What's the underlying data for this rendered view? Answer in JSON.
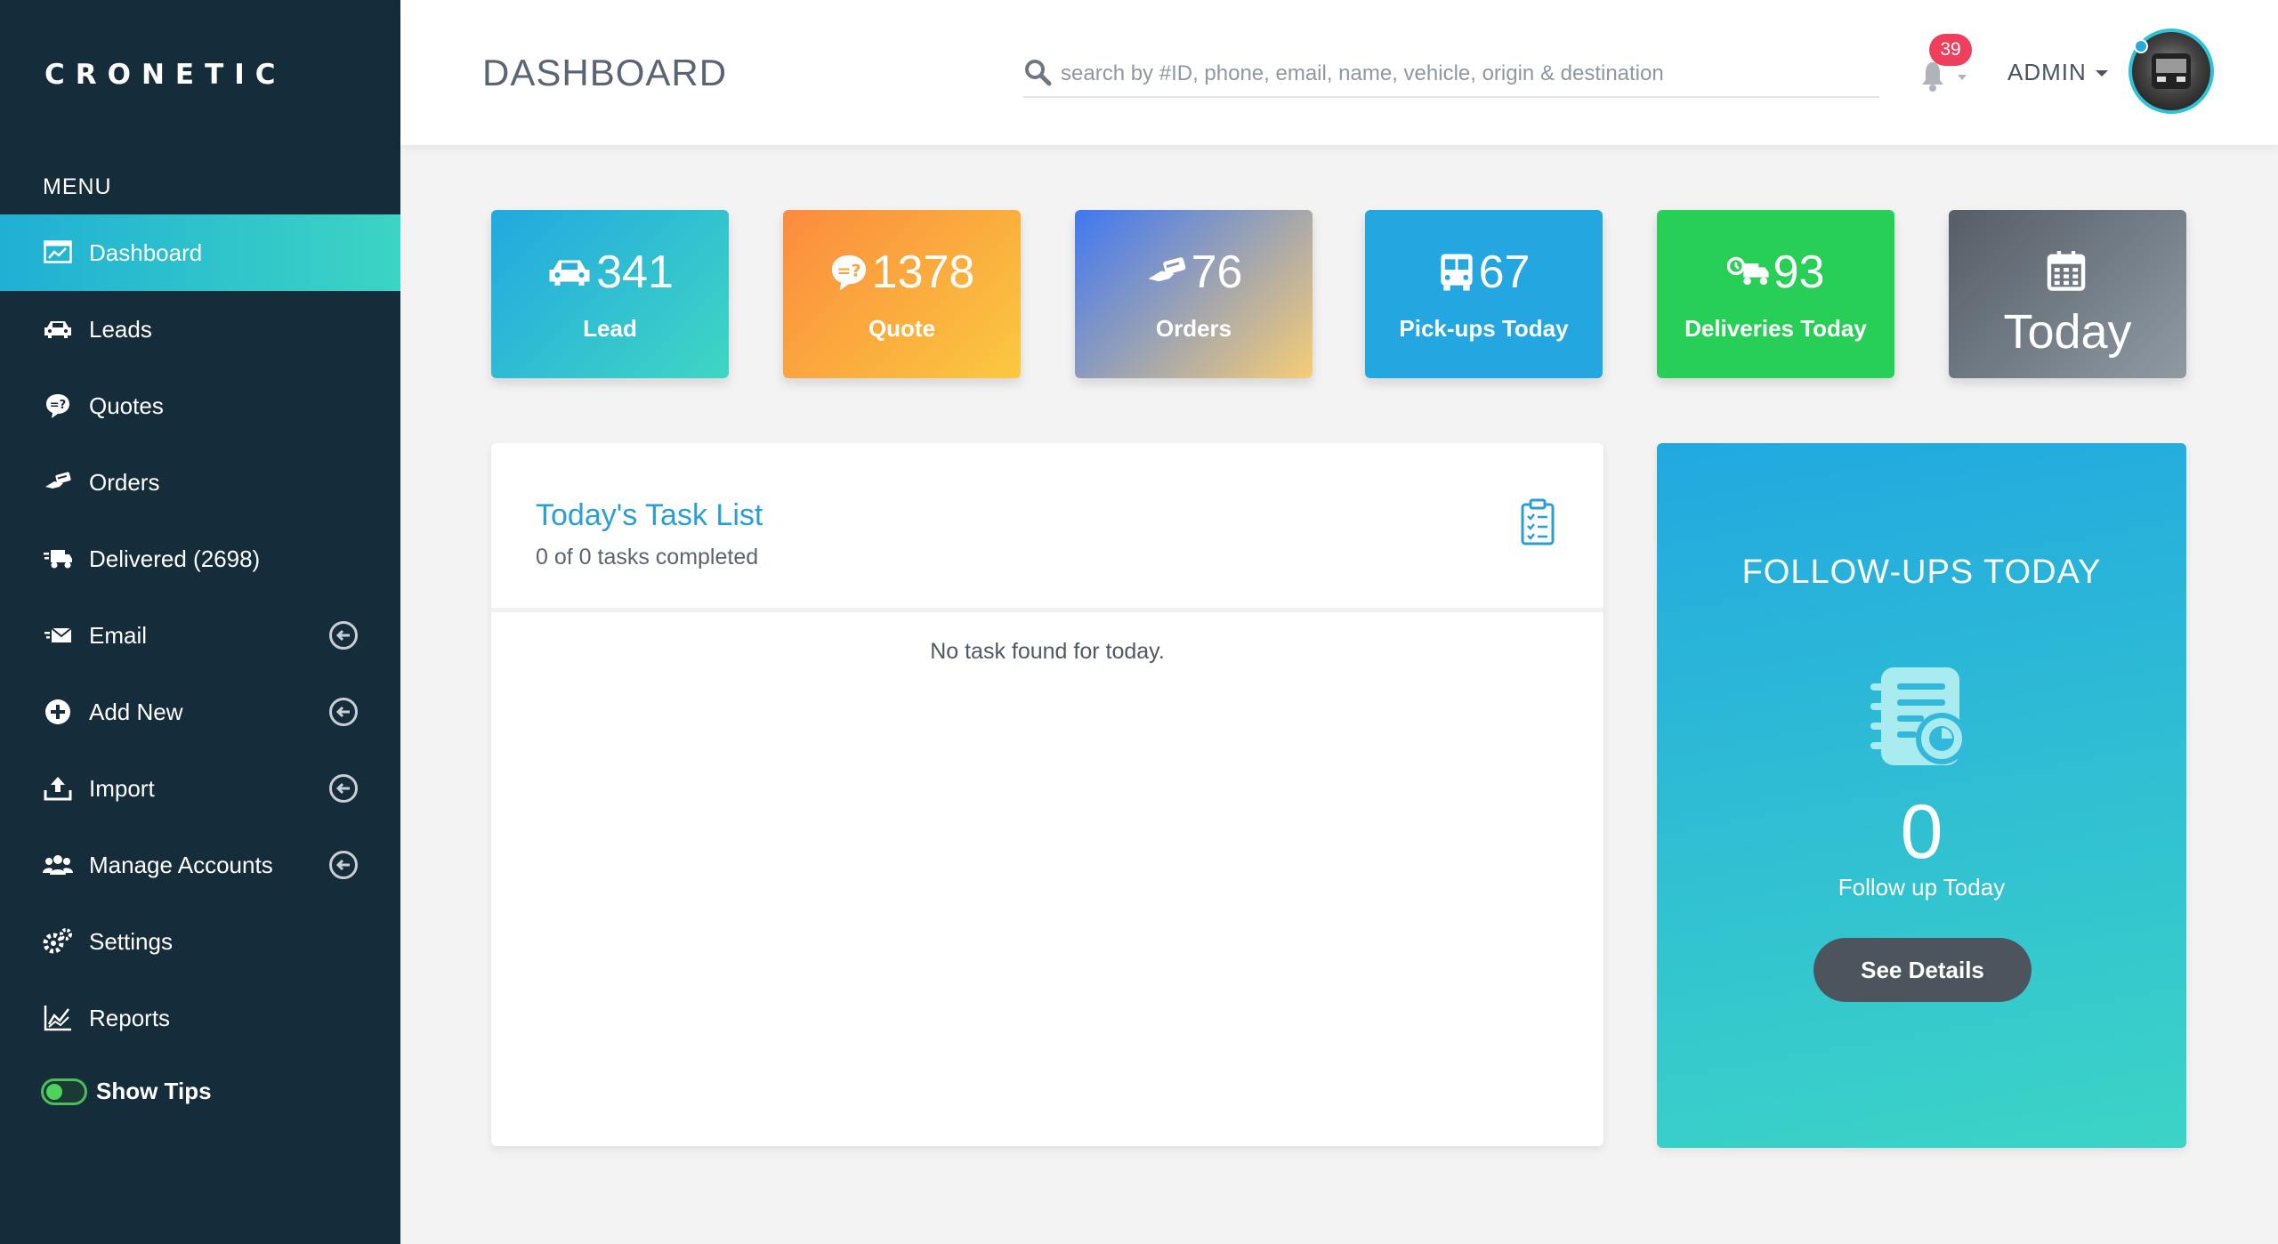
{
  "app": {
    "logo": "CRONETIC"
  },
  "sidebar": {
    "menu_label": "MENU",
    "items": [
      {
        "label": "Dashboard",
        "icon": "dashboard-icon",
        "active": true
      },
      {
        "label": "Leads",
        "icon": "car-icon"
      },
      {
        "label": "Quotes",
        "icon": "quote-bubble-icon"
      },
      {
        "label": "Orders",
        "icon": "order-icon"
      },
      {
        "label": "Delivered (2698)",
        "icon": "truck-icon"
      },
      {
        "label": "Email",
        "icon": "email-icon",
        "expandable": true
      },
      {
        "label": "Add New",
        "icon": "plus-circle-icon",
        "expandable": true
      },
      {
        "label": "Import",
        "icon": "upload-icon",
        "expandable": true
      },
      {
        "label": "Manage Accounts",
        "icon": "users-icon",
        "expandable": true
      },
      {
        "label": "Settings",
        "icon": "gears-icon"
      },
      {
        "label": "Reports",
        "icon": "chart-line-icon"
      }
    ],
    "tips_label": "Show Tips",
    "tips_on": true
  },
  "header": {
    "title": "DASHBOARD",
    "search_placeholder": "search by #ID, phone, email, name, vehicle, origin & destination",
    "notification_count": "39",
    "user_label": "ADMIN"
  },
  "stats": {
    "lead": {
      "value": "341",
      "label": "Lead"
    },
    "quote": {
      "value": "1378",
      "label": "Quote"
    },
    "orders": {
      "value": "76",
      "label": "Orders"
    },
    "pickups": {
      "value": "67",
      "label": "Pick-ups Today"
    },
    "deliveries": {
      "value": "93",
      "label": "Deliveries Today"
    },
    "today": {
      "label": "Today"
    }
  },
  "tasks": {
    "title": "Today's Task List",
    "subtitle": "0 of 0 tasks completed",
    "empty_text": "No task found for today."
  },
  "followups": {
    "title": "FOLLOW-UPS TODAY",
    "count": "0",
    "label": "Follow up Today",
    "button": "See Details"
  },
  "colors": {
    "sidebar_bg": "#152c3a",
    "accent_teal": "#2fc3d8",
    "badge_red": "#ee3f5c",
    "link_blue": "#2a9fd6"
  }
}
